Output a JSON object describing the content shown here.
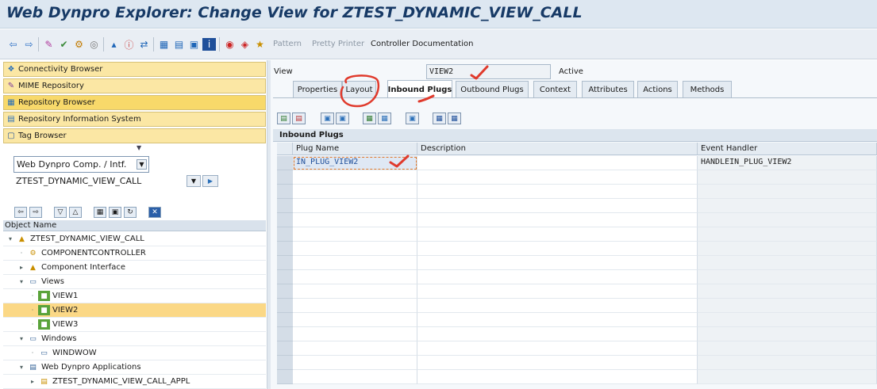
{
  "window": {
    "title": "Web Dynpro Explorer: Change View for ZTEST_DYNAMIC_VIEW_CALL"
  },
  "toolbar": {
    "pattern_label": "Pattern",
    "pretty_printer_label": "Pretty Printer",
    "controller_doc_label": "Controller Documentation"
  },
  "nav": {
    "buttons": [
      {
        "label": "Connectivity Browser"
      },
      {
        "label": "MIME Repository"
      },
      {
        "label": "Repository Browser"
      },
      {
        "label": "Repository Information System"
      },
      {
        "label": "Tag Browser"
      }
    ],
    "object_type_value": "Web Dynpro Comp. / Intf.",
    "object_name_value": "ZTEST_DYNAMIC_VIEW_CALL"
  },
  "tree": {
    "header": "Object Name",
    "rows": [
      {
        "label": "ZTEST_DYNAMIC_VIEW_CALL"
      },
      {
        "label": "COMPONENTCONTROLLER"
      },
      {
        "label": "Component Interface"
      },
      {
        "label": "Views"
      },
      {
        "label": "VIEW1"
      },
      {
        "label": "VIEW2"
      },
      {
        "label": "VIEW3"
      },
      {
        "label": "Windows"
      },
      {
        "label": "WINDWOW"
      },
      {
        "label": "Web Dynpro Applications"
      },
      {
        "label": "ZTEST_DYNAMIC_VIEW_CALL_APPL"
      }
    ]
  },
  "view": {
    "label": "View",
    "name": "VIEW2",
    "status": "Active"
  },
  "tabs": [
    {
      "label": "Properties"
    },
    {
      "label": "Layout"
    },
    {
      "label": "Inbound Plugs"
    },
    {
      "label": "Outbound Plugs"
    },
    {
      "label": "Context"
    },
    {
      "label": "Attributes"
    },
    {
      "label": "Actions"
    },
    {
      "label": "Methods"
    }
  ],
  "grid": {
    "title": "Inbound Plugs",
    "columns": [
      "Plug Name",
      "Description",
      "Event Handler"
    ],
    "rows": [
      {
        "plug": "IN_PLUG_VIEW2",
        "description": "",
        "handler": "HANDLEIN_PLUG_VIEW2"
      }
    ]
  },
  "colors": {
    "title_text": "#173a66",
    "nav_button": "#fbe7a4",
    "selected_row": "#fbd886",
    "annotation": "#e03a2c"
  }
}
